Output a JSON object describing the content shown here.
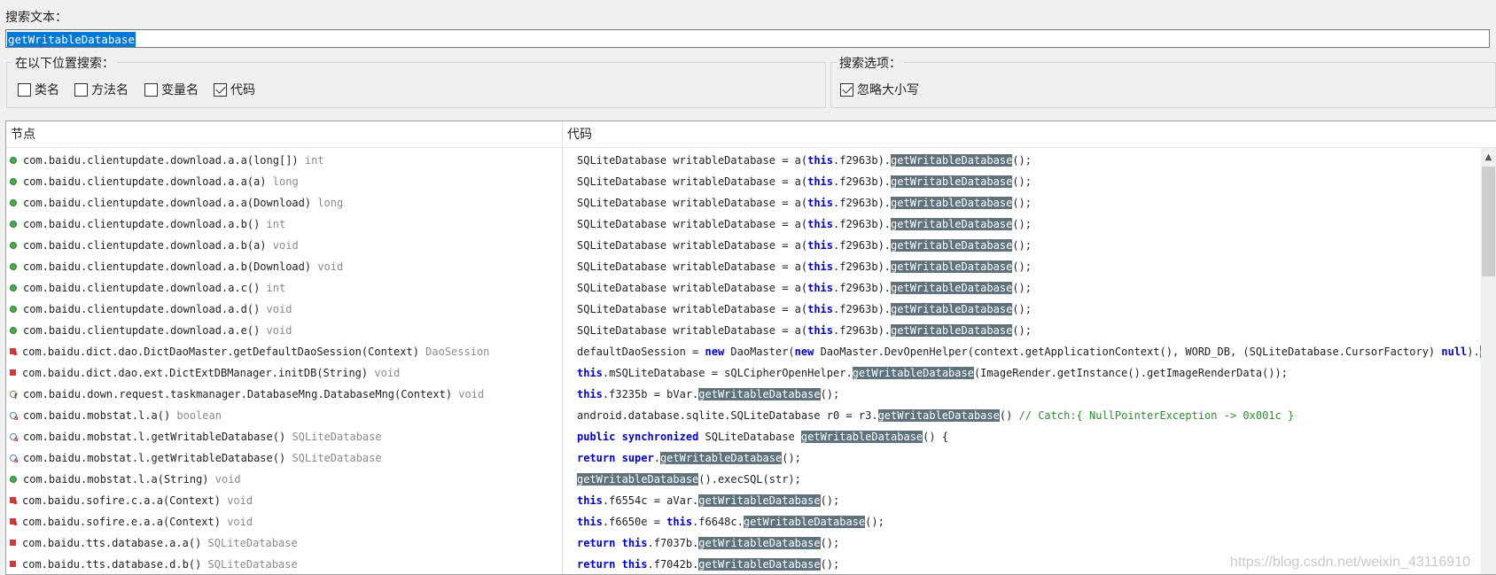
{
  "search": {
    "label": "搜索文本：",
    "value": "getWritableDatabase"
  },
  "locations": {
    "title": "在以下位置搜索：",
    "options": [
      {
        "label": "类名",
        "checked": false
      },
      {
        "label": "方法名",
        "checked": false
      },
      {
        "label": "变量名",
        "checked": false
      },
      {
        "label": "代码",
        "checked": true
      }
    ]
  },
  "search_options": {
    "title": "搜索选项：",
    "ignore_case": {
      "label": "忽略大小写",
      "checked": true
    }
  },
  "results": {
    "columns": {
      "node": "节点",
      "code": "代码"
    },
    "rows": [
      {
        "icon": "public-method-icon",
        "node": "com.baidu.clientupdate.download.a.a(long[])",
        "ret": "int",
        "code": [
          {
            "t": "SQLiteDatabase writableDatabase = a("
          },
          {
            "t": "this",
            "k": "kw"
          },
          {
            "t": ".f2963b)."
          },
          {
            "t": "getWritableDatabase",
            "k": "hl"
          },
          {
            "t": "();"
          }
        ]
      },
      {
        "icon": "public-method-icon",
        "node": "com.baidu.clientupdate.download.a.a(a)",
        "ret": "long",
        "code": [
          {
            "t": "SQLiteDatabase writableDatabase = a("
          },
          {
            "t": "this",
            "k": "kw"
          },
          {
            "t": ".f2963b)."
          },
          {
            "t": "getWritableDatabase",
            "k": "hl"
          },
          {
            "t": "();"
          }
        ]
      },
      {
        "icon": "public-method-icon",
        "node": "com.baidu.clientupdate.download.a.a(Download)",
        "ret": "long",
        "code": [
          {
            "t": "SQLiteDatabase writableDatabase = a("
          },
          {
            "t": "this",
            "k": "kw"
          },
          {
            "t": ".f2963b)."
          },
          {
            "t": "getWritableDatabase",
            "k": "hl"
          },
          {
            "t": "();"
          }
        ]
      },
      {
        "icon": "public-method-icon",
        "node": "com.baidu.clientupdate.download.a.b()",
        "ret": "int",
        "code": [
          {
            "t": "SQLiteDatabase writableDatabase = a("
          },
          {
            "t": "this",
            "k": "kw"
          },
          {
            "t": ".f2963b)."
          },
          {
            "t": "getWritableDatabase",
            "k": "hl"
          },
          {
            "t": "();"
          }
        ]
      },
      {
        "icon": "public-method-icon",
        "node": "com.baidu.clientupdate.download.a.b(a)",
        "ret": "void",
        "code": [
          {
            "t": "SQLiteDatabase writableDatabase = a("
          },
          {
            "t": "this",
            "k": "kw"
          },
          {
            "t": ".f2963b)."
          },
          {
            "t": "getWritableDatabase",
            "k": "hl"
          },
          {
            "t": "();"
          }
        ]
      },
      {
        "icon": "public-method-icon",
        "node": "com.baidu.clientupdate.download.a.b(Download)",
        "ret": "void",
        "code": [
          {
            "t": "SQLiteDatabase writableDatabase = a("
          },
          {
            "t": "this",
            "k": "kw"
          },
          {
            "t": ".f2963b)."
          },
          {
            "t": "getWritableDatabase",
            "k": "hl"
          },
          {
            "t": "();"
          }
        ]
      },
      {
        "icon": "public-method-icon",
        "node": "com.baidu.clientupdate.download.a.c()",
        "ret": "int",
        "code": [
          {
            "t": "SQLiteDatabase writableDatabase = a("
          },
          {
            "t": "this",
            "k": "kw"
          },
          {
            "t": ".f2963b)."
          },
          {
            "t": "getWritableDatabase",
            "k": "hl"
          },
          {
            "t": "();"
          }
        ]
      },
      {
        "icon": "public-method-icon",
        "node": "com.baidu.clientupdate.download.a.d()",
        "ret": "void",
        "code": [
          {
            "t": "SQLiteDatabase writableDatabase = a("
          },
          {
            "t": "this",
            "k": "kw"
          },
          {
            "t": ".f2963b)."
          },
          {
            "t": "getWritableDatabase",
            "k": "hl"
          },
          {
            "t": "();"
          }
        ]
      },
      {
        "icon": "public-method-icon",
        "node": "com.baidu.clientupdate.download.a.e()",
        "ret": "void",
        "code": [
          {
            "t": "SQLiteDatabase writableDatabase = a("
          },
          {
            "t": "this",
            "k": "kw"
          },
          {
            "t": ".f2963b)."
          },
          {
            "t": "getWritableDatabase",
            "k": "hl"
          },
          {
            "t": "();"
          }
        ]
      },
      {
        "icon": "static-private-method-icon",
        "node": "com.baidu.dict.dao.DictDaoMaster.getDefaultDaoSession(Context)",
        "ret": "DaoSession",
        "code": [
          {
            "t": "defaultDaoSession = "
          },
          {
            "t": "new",
            "k": "kw"
          },
          {
            "t": " DaoMaster("
          },
          {
            "t": "new",
            "k": "kw"
          },
          {
            "t": " DaoMaster.DevOpenHelper(context.getApplicationContext(), WORD_DB, (SQLiteDatabase.CursorFactory) "
          },
          {
            "t": "null",
            "k": "kw"
          },
          {
            "t": ")."
          },
          {
            "t": "getWr",
            "k": "hl"
          }
        ]
      },
      {
        "icon": "private-method-icon",
        "node": "com.baidu.dict.dao.ext.DictExtDBManager.initDB(String)",
        "ret": "void",
        "code": [
          {
            "t": "this",
            "k": "kw"
          },
          {
            "t": ".mSQLiteDatabase = sQLCipherOpenHelper."
          },
          {
            "t": "getWritableDatabase",
            "k": "hl"
          },
          {
            "t": "(ImageRender.getInstance().getImageRenderData());"
          }
        ]
      },
      {
        "icon": "final-method-icon",
        "node": "com.baidu.down.request.taskmanager.DatabaseMng.DatabaseMng(Context)",
        "ret": "void",
        "code": [
          {
            "t": "this",
            "k": "kw"
          },
          {
            "t": ".f3235b = bVar."
          },
          {
            "t": "getWritableDatabase",
            "k": "hl"
          },
          {
            "t": "();"
          }
        ]
      },
      {
        "icon": "static-method-icon",
        "node": "com.baidu.mobstat.l.a()",
        "ret": "boolean",
        "code": [
          {
            "t": "android.database.sqlite.SQLiteDatabase r0 = r3."
          },
          {
            "t": "getWritableDatabase",
            "k": "hl"
          },
          {
            "t": "()     "
          },
          {
            "t": "// Catch:{ NullPointerException -> 0x001c }",
            "k": "cm"
          }
        ]
      },
      {
        "icon": "static-method-icon",
        "node": "com.baidu.mobstat.l.getWritableDatabase()",
        "ret": "SQLiteDatabase",
        "code": [
          {
            "t": "public",
            "k": "kw"
          },
          {
            "t": " "
          },
          {
            "t": "synchronized",
            "k": "kw"
          },
          {
            "t": " SQLiteDatabase "
          },
          {
            "t": "getWritableDatabase",
            "k": "hl"
          },
          {
            "t": "() {"
          }
        ]
      },
      {
        "icon": "static-method-icon",
        "node": "com.baidu.mobstat.l.getWritableDatabase()",
        "ret": "SQLiteDatabase",
        "code": [
          {
            "t": "return",
            "k": "kw"
          },
          {
            "t": " "
          },
          {
            "t": "super",
            "k": "kw"
          },
          {
            "t": "."
          },
          {
            "t": "getWritableDatabase",
            "k": "hl"
          },
          {
            "t": "();"
          }
        ]
      },
      {
        "icon": "public-method-icon",
        "node": "com.baidu.mobstat.l.a(String)",
        "ret": "void",
        "code": [
          {
            "t": "getWritableDatabase",
            "k": "hl"
          },
          {
            "t": "().execSQL(str);"
          }
        ]
      },
      {
        "icon": "static-private-method-icon",
        "node": "com.baidu.sofire.c.a.a(Context)",
        "ret": "void",
        "code": [
          {
            "t": "this",
            "k": "kw"
          },
          {
            "t": ".f6554c = aVar."
          },
          {
            "t": "getWritableDatabase",
            "k": "hl"
          },
          {
            "t": "();"
          }
        ]
      },
      {
        "icon": "static-private-method-icon",
        "node": "com.baidu.sofire.e.a.a(Context)",
        "ret": "void",
        "code": [
          {
            "t": "this",
            "k": "kw"
          },
          {
            "t": ".f6650e = "
          },
          {
            "t": "this",
            "k": "kw"
          },
          {
            "t": ".f6648c."
          },
          {
            "t": "getWritableDatabase",
            "k": "hl"
          },
          {
            "t": "();"
          }
        ]
      },
      {
        "icon": "private-method-icon",
        "node": "com.baidu.tts.database.a.a()",
        "ret": "SQLiteDatabase",
        "code": [
          {
            "t": "return",
            "k": "kw"
          },
          {
            "t": " "
          },
          {
            "t": "this",
            "k": "kw"
          },
          {
            "t": ".f7037b."
          },
          {
            "t": "getWritableDatabase",
            "k": "hl"
          },
          {
            "t": "();"
          }
        ]
      },
      {
        "icon": "private-method-icon",
        "node": "com.baidu.tts.database.d.b()",
        "ret": "SQLiteDatabase",
        "code": [
          {
            "t": "return",
            "k": "kw"
          },
          {
            "t": " "
          },
          {
            "t": "this",
            "k": "kw"
          },
          {
            "t": ".f7042b."
          },
          {
            "t": "getWritableDatabase",
            "k": "hl"
          },
          {
            "t": "();"
          }
        ]
      }
    ]
  },
  "watermark": "https://blog.csdn.net/weixin_43116910"
}
